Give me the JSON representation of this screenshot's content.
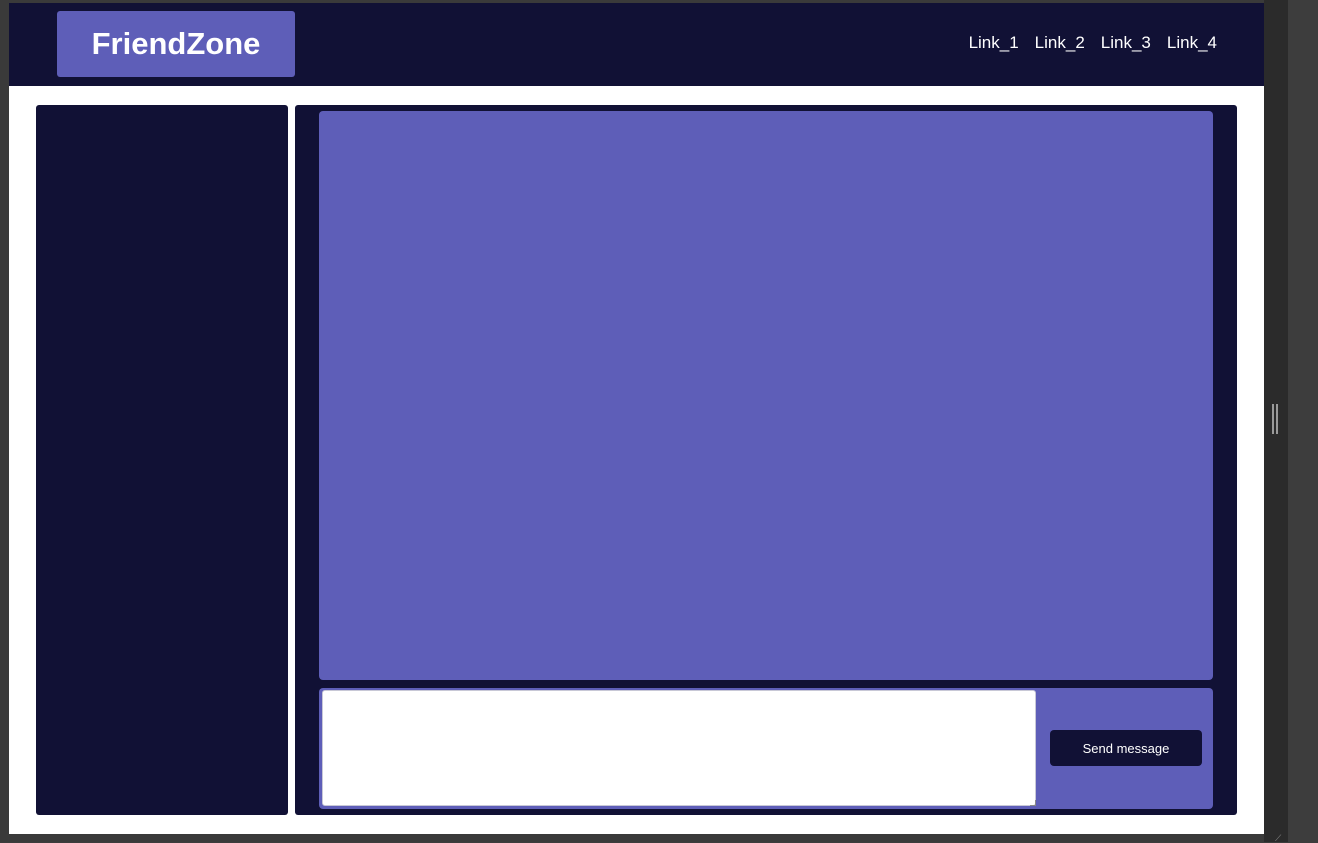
{
  "header": {
    "brand": "FriendZone",
    "links": [
      "Link_1",
      "Link_2",
      "Link_3",
      "Link_4"
    ]
  },
  "chat": {
    "input_value": "",
    "send_label": "Send message"
  },
  "colors": {
    "dark_navy": "#111135",
    "accent_purple": "#5e5eb8",
    "text_white": "#ffffff"
  }
}
